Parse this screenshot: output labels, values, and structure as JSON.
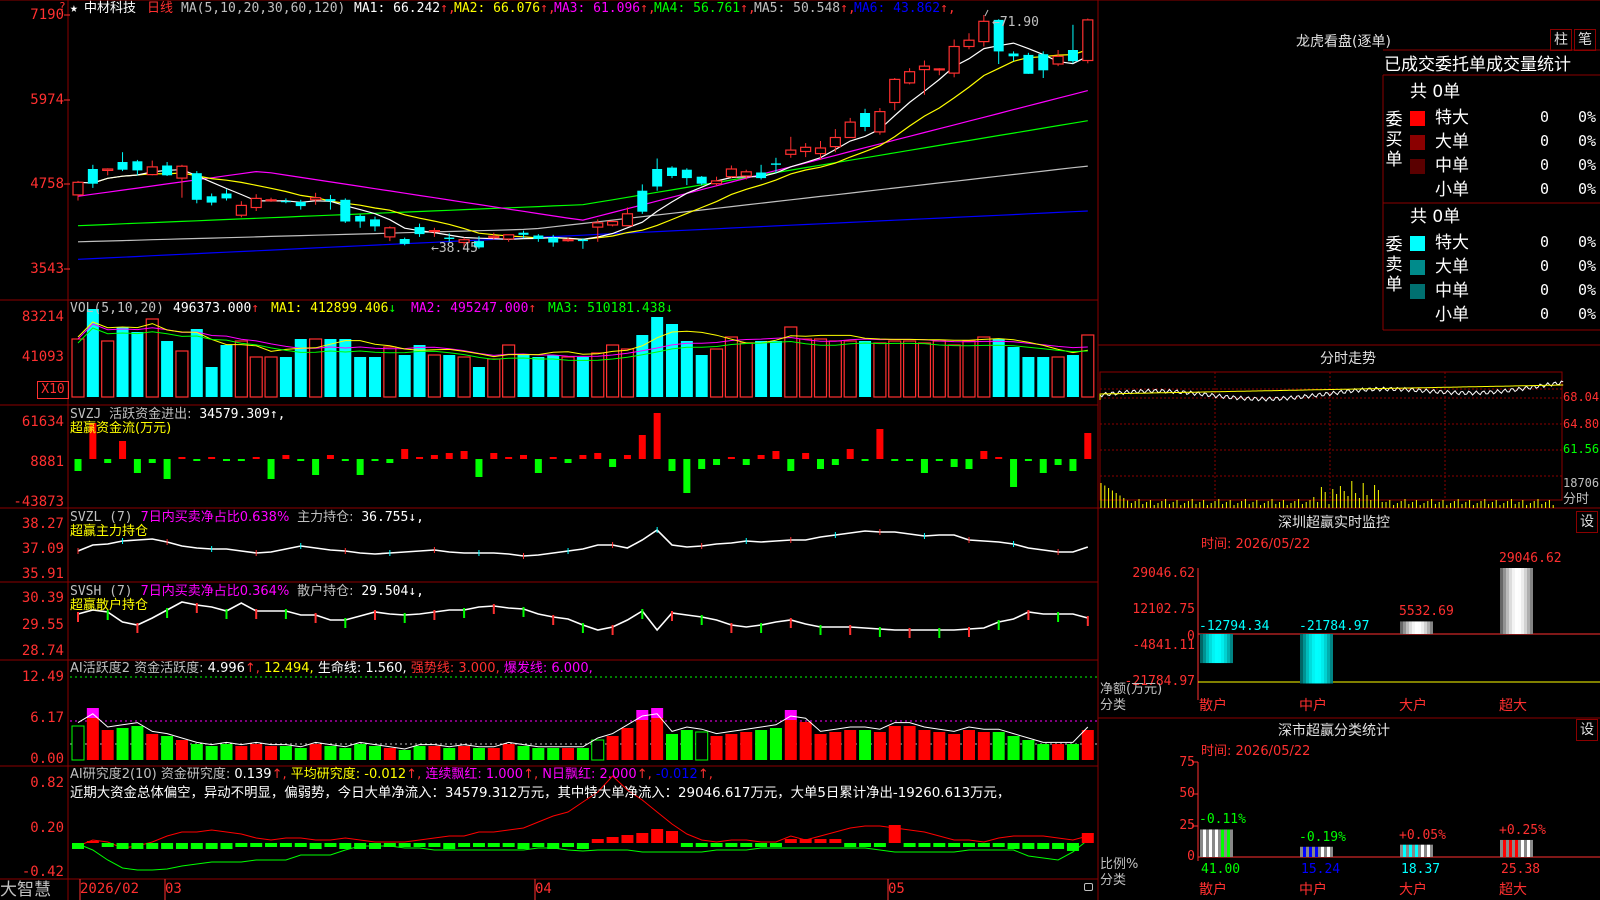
{
  "stock": {
    "name": "中材科技",
    "period": "日线",
    "star": "★",
    "question": "?"
  },
  "ma_line": {
    "prefix": "MA(5,10,20,30,60,120)",
    "items": [
      {
        "label": "MA1:",
        "value": "66.242",
        "dir": "↑",
        "color": "#ffffff"
      },
      {
        "label": "MA2:",
        "value": "66.076",
        "dir": "↑",
        "color": "#ffff00"
      },
      {
        "label": "MA3:",
        "value": "61.096",
        "dir": "↑",
        "color": "#ff00ff"
      },
      {
        "label": "MA4:",
        "value": "56.761",
        "dir": "↑",
        "color": "#00ff00"
      },
      {
        "label": "MA5:",
        "value": "50.548",
        "dir": "↑",
        "color": "#c0c0c0"
      },
      {
        "label": "MA6:",
        "value": "43.862",
        "dir": "↑",
        "color": "#0000ff"
      }
    ]
  },
  "price_axis": [
    "7190",
    "5974",
    "4758",
    "3543"
  ],
  "annotations": {
    "high": "71.90",
    "low": "38.45"
  },
  "vol": {
    "title": "VOL(5,10,20)",
    "value": "496373.000",
    "value_dir": "↑",
    "ma1": "MA1: 412899.406",
    "ma1_dir": "↓",
    "ma2": "MA2: 495247.000",
    "ma2_dir": "↑",
    "ma3": "MA3: 510181.438",
    "ma3_dir": "↓",
    "axis": [
      "83214",
      "41093"
    ],
    "unit": "X10"
  },
  "svzj": {
    "title": "SVZJ",
    "label": "活跃资金进出:",
    "value": "34579.309",
    "dir": "↑,",
    "sub": "超赢资金流(万元)",
    "axis": [
      "61634",
      "8881",
      "-43873"
    ]
  },
  "svzl": {
    "title": "SVZL (7)",
    "label": "7日内买卖净占比0.638%",
    "label2": "主力持仓:",
    "value": "36.755",
    "dir": "↓,",
    "sub": "超赢主力持仓",
    "axis": [
      "38.27",
      "37.09",
      "35.91"
    ]
  },
  "svsh": {
    "title": "SVSH (7)",
    "label": "7日内买卖净占比0.364%",
    "label2": "散户持仓:",
    "value": "29.504",
    "dir": "↓,",
    "sub": "超赢散户持仓",
    "axis": [
      "30.39",
      "29.55",
      "28.74"
    ]
  },
  "ai1": {
    "title": "AI活跃度2",
    "label": "资金活跃度:",
    "value": "4.996",
    "dir": "↑,",
    "v2": "12.494,",
    "life": "生命线: 1.560,",
    "strong": "强势线: 3.000,",
    "burst": "爆发线: 6.000,",
    "axis": [
      "12.49",
      "6.17",
      "0.00"
    ]
  },
  "ai2": {
    "title": "AI研究度2(10)",
    "label": "资金研究度:",
    "value": "0.139",
    "dir": "↑,",
    "avg": "平均研究度: -0.012",
    "avg_dir": "↑,",
    "red1": "连续飘红: 1.000",
    "red1_dir": "↑,",
    "red2": "N日飘红: 2.000",
    "red2_dir": "↑,",
    "tail": "-0.012",
    "tail_dir": "↑,",
    "commentary": "近期大资金总体偏空，异动不明显，偏弱势，今日大单净流入：34579.312万元，其中特大单净流入：29046.617万元，大单5日累计净出-19260.613万元，",
    "axis": [
      "0.82",
      "0.20",
      "-0.42"
    ]
  },
  "date_axis": [
    "2026/02",
    "03",
    "04",
    "05"
  ],
  "brand": "大智慧",
  "lhb": {
    "title": "龙虎看盘(逐单)",
    "btn1": "柱",
    "btn2": "笔",
    "header": "已成交委托单成交量统计",
    "buy": {
      "side": "委买单",
      "total": "共 0单",
      "rows": [
        {
          "label": "特大",
          "v": "0",
          "p": "0%",
          "color": "#ff0000"
        },
        {
          "label": "大单",
          "v": "0",
          "p": "0%",
          "color": "#8b0000"
        },
        {
          "label": "中单",
          "v": "0",
          "p": "0%",
          "color": "#5a0000"
        },
        {
          "label": "小单",
          "v": "0",
          "p": "0%",
          "color": ""
        }
      ]
    },
    "sell": {
      "side": "委卖单",
      "total": "共 0单",
      "rows": [
        {
          "label": "特大",
          "v": "0",
          "p": "0%",
          "color": "#00ffff"
        },
        {
          "label": "大单",
          "v": "0",
          "p": "0%",
          "color": "#008b8b"
        },
        {
          "label": "中单",
          "v": "0",
          "p": "0%",
          "color": "#007070"
        },
        {
          "label": "小单",
          "v": "0",
          "p": "0%",
          "color": ""
        }
      ]
    }
  },
  "intraday": {
    "title": "分时走势",
    "axis": [
      "68.04",
      "64.80",
      "61.56"
    ],
    "vol": "18706",
    "vol_label": "分时"
  },
  "monitor": {
    "title": "深圳超赢实时监控",
    "btn": "设",
    "time": "时间: 2026/05/22",
    "axis": [
      "29046.62",
      "12102.75",
      "-4841.11",
      "-21784.97"
    ],
    "zero": "0",
    "ylabel": "净额(万元)",
    "xlabel": "分类",
    "categories": [
      "散户",
      "中户",
      "大户",
      "超大"
    ],
    "values": [
      "-12794.34",
      "-21784.97",
      "5532.69",
      "29046.62"
    ]
  },
  "stats": {
    "title": "深市超赢分类统计",
    "btn": "设",
    "time": "时间: 2026/05/22",
    "axis": [
      "75",
      "50",
      "25",
      "0"
    ],
    "ylabel": "比例%",
    "xlabel": "分类",
    "categories": [
      "散户",
      "中户",
      "大户",
      "超大"
    ],
    "values": [
      "41.00",
      "15.24",
      "18.37",
      "25.38"
    ],
    "changes": [
      "-0.11%",
      "-0.19%",
      "+0.05%",
      "+0.25%"
    ]
  },
  "kline": [
    [
      46.2,
      48.0,
      45.4,
      48.2
    ],
    [
      49.9,
      47.8,
      47.2,
      50.5
    ],
    [
      49.7,
      49.9,
      49.0,
      50.0
    ],
    [
      50.9,
      49.8,
      49.6,
      52.3
    ],
    [
      51.0,
      49.7,
      49.0,
      51.2
    ],
    [
      49.1,
      50.2,
      49.0,
      51.1
    ],
    [
      50.4,
      49.0,
      48.9,
      50.9
    ],
    [
      48.6,
      50.3,
      45.8,
      50.5
    ],
    [
      49.3,
      45.5,
      45.0,
      49.6
    ],
    [
      46.0,
      45.1,
      44.7,
      46.4
    ],
    [
      46.4,
      45.7,
      45.4,
      47.0
    ],
    [
      43.3,
      44.7,
      43.0,
      45.3
    ],
    [
      44.4,
      45.7,
      43.9,
      46.3
    ],
    [
      45.5,
      45.5,
      45.2,
      45.8
    ],
    [
      45.3,
      45.2,
      45.0,
      45.7
    ],
    [
      45.2,
      44.6,
      44.1,
      45.5
    ],
    [
      45.5,
      45.8,
      44.8,
      46.5
    ],
    [
      45.6,
      45.3,
      44.1,
      46.2
    ],
    [
      45.5,
      42.4,
      42.2,
      45.7
    ],
    [
      43.2,
      42.4,
      41.5,
      43.4
    ],
    [
      42.7,
      41.7,
      41.0,
      43.1
    ],
    [
      40.2,
      41.5,
      39.6,
      41.7
    ],
    [
      39.9,
      39.2,
      39.0,
      40.1
    ],
    [
      41.6,
      40.6,
      40.2,
      42.1
    ],
    [
      41.1,
      41.1,
      40.2,
      41.5
    ],
    [
      40.1,
      39.9,
      39.5,
      40.7
    ],
    [
      39.4,
      39.8,
      38.5,
      40.1
    ],
    [
      39.6,
      38.7,
      38.5,
      40.3
    ],
    [
      40.1,
      40.3,
      39.8,
      40.8
    ],
    [
      39.9,
      40.5,
      39.5,
      40.5
    ],
    [
      40.8,
      40.5,
      40.0,
      41.1
    ],
    [
      40.4,
      39.9,
      39.5,
      40.6
    ],
    [
      40.1,
      39.4,
      38.8,
      40.5
    ],
    [
      39.7,
      39.8,
      39.5,
      40.1
    ],
    [
      39.8,
      39.6,
      38.5,
      40.0
    ],
    [
      41.6,
      42.2,
      39.5,
      42.7
    ],
    [
      41.9,
      42.4,
      41.7,
      42.5
    ],
    [
      41.8,
      43.5,
      41.7,
      44.4
    ],
    [
      46.8,
      43.8,
      43.5,
      47.7
    ],
    [
      49.9,
      47.4,
      46.8,
      51.4
    ],
    [
      50.1,
      48.9,
      48.6,
      50.3
    ],
    [
      49.8,
      48.6,
      47.6,
      50.0
    ],
    [
      48.8,
      47.8,
      47.6,
      48.9
    ],
    [
      47.8,
      48.2,
      47.5,
      48.8
    ],
    [
      48.8,
      49.9,
      48.6,
      50.4
    ],
    [
      48.9,
      49.5,
      48.4,
      49.8
    ],
    [
      49.4,
      48.6,
      48.4,
      50.5
    ],
    [
      50.7,
      50.5,
      49.3,
      51.5
    ],
    [
      52.0,
      52.6,
      51.5,
      54.5
    ],
    [
      52.4,
      53.0,
      51.6,
      53.6
    ],
    [
      52.1,
      52.9,
      51.2,
      53.9
    ],
    [
      53.1,
      54.4,
      52.3,
      55.6
    ],
    [
      54.4,
      56.6,
      54.4,
      57.2
    ],
    [
      57.9,
      55.9,
      55.3,
      58.5
    ],
    [
      55.2,
      58.1,
      54.8,
      58.6
    ],
    [
      59.4,
      62.7,
      58.3,
      62.9
    ],
    [
      62.2,
      63.8,
      62.0,
      64.3
    ],
    [
      64.1,
      64.6,
      60.5,
      65.4
    ],
    [
      64.1,
      64.2,
      63.3,
      64.3
    ],
    [
      63.6,
      67.4,
      63.0,
      68.4
    ],
    [
      67.4,
      68.3,
      67.0,
      69.3
    ],
    [
      68.1,
      71.0,
      67.4,
      71.9
    ],
    [
      71.2,
      66.7,
      64.9,
      71.3
    ],
    [
      66.4,
      66.0,
      65.3,
      66.7
    ],
    [
      66.2,
      63.5,
      63.5,
      66.5
    ],
    [
      66.3,
      64.0,
      62.9,
      66.7
    ],
    [
      64.9,
      66.0,
      64.6,
      66.9
    ],
    [
      66.9,
      65.3,
      65.0,
      70.5
    ],
    [
      65.4,
      71.2,
      65.0,
      71.4
    ]
  ]
}
